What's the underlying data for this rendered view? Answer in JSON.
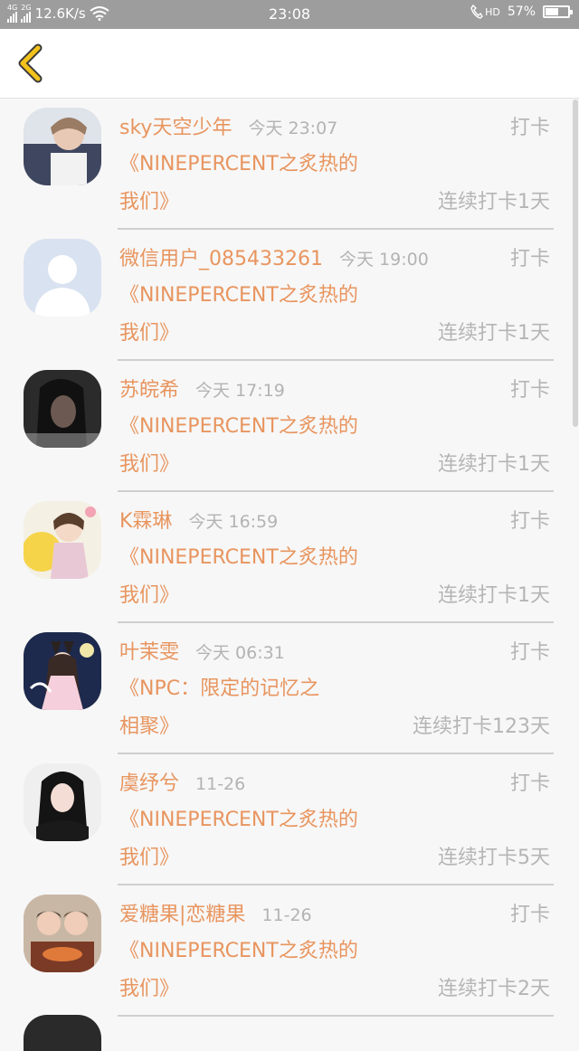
{
  "status_bar": {
    "sim1": "4G",
    "sim2": "2G",
    "speed": "12.6K/s",
    "time": "23:08",
    "hd": "HD",
    "battery": "57%",
    "battery_level": 0.57
  },
  "header": {
    "back_icon": "chevron-left-icon",
    "accent": "#f3c31c"
  },
  "colors": {
    "name": "#e8955f",
    "muted": "#b5b5b5"
  },
  "items": [
    {
      "name": "sky天空少年",
      "time": "今天 23:07",
      "action": "打卡",
      "title_line1": "《NINEPERCENT之炙热的",
      "title_line2": "我们》",
      "streak": "连续打卡1天"
    },
    {
      "name": "微信用户_085433261",
      "time": "今天 19:00",
      "action": "打卡",
      "title_line1": "《NINEPERCENT之炙热的",
      "title_line2": "我们》",
      "streak": "连续打卡1天"
    },
    {
      "name": "苏皖希",
      "time": "今天 17:19",
      "action": "打卡",
      "title_line1": "《NINEPERCENT之炙热的",
      "title_line2": "我们》",
      "streak": "连续打卡1天"
    },
    {
      "name": "K霖琳",
      "time": "今天 16:59",
      "action": "打卡",
      "title_line1": "《NINEPERCENT之炙热的",
      "title_line2": "我们》",
      "streak": "连续打卡1天"
    },
    {
      "name": "叶茉雯",
      "time": "今天 06:31",
      "action": "打卡",
      "title_line1": "《NPC：限定的记忆之",
      "title_line2": "相聚》",
      "streak": "连续打卡123天"
    },
    {
      "name": "虞纾兮",
      "time": "11-26",
      "action": "打卡",
      "title_line1": "《NINEPERCENT之炙热的",
      "title_line2": "我们》",
      "streak": "连续打卡5天"
    },
    {
      "name": "爱糖果|恋糖果",
      "time": "11-26",
      "action": "打卡",
      "title_line1": "《NINEPERCENT之炙热的",
      "title_line2": "我们》",
      "streak": "连续打卡2天"
    }
  ]
}
